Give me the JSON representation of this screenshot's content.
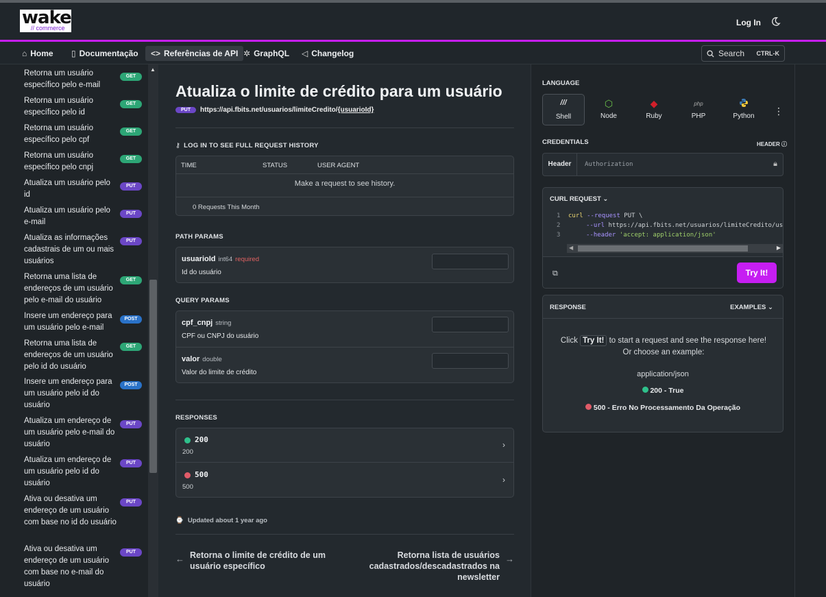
{
  "header": {
    "logo_text": "wake",
    "logo_sub": "// commerce",
    "login": "Log In"
  },
  "nav": {
    "items": [
      {
        "label": "Home",
        "icon": "home-icon"
      },
      {
        "label": "Documentação",
        "icon": "book-icon"
      },
      {
        "label": "Referências de API",
        "icon": "code-icon"
      },
      {
        "label": "GraphQL",
        "icon": "graphql-icon"
      },
      {
        "label": "Changelog",
        "icon": "megaphone-icon"
      }
    ],
    "search_label": "Search",
    "search_shortcut": "CTRL-K"
  },
  "sidebar": {
    "items": [
      {
        "label": "Retorna um usuário específico pelo e-mail",
        "method": "GET"
      },
      {
        "label": "Retorna um usuário específico pelo id",
        "method": "GET"
      },
      {
        "label": "Retorna um usuário específico pelo cpf",
        "method": "GET"
      },
      {
        "label": "Retorna um usuário específico pelo cnpj",
        "method": "GET"
      },
      {
        "label": "Atualiza um usuário pelo id",
        "method": "PUT"
      },
      {
        "label": "Atualiza um usuário pelo e-mail",
        "method": "PUT"
      },
      {
        "label": "Atualiza as informações cadastrais de um ou mais usuários",
        "method": "PUT"
      },
      {
        "label": "Retorna uma lista de endereços de um usuário pelo e-mail do usuário",
        "method": "GET"
      },
      {
        "label": "Insere um endereço para um usuário pelo e-mail",
        "method": "POST"
      },
      {
        "label": "Retorna uma lista de endereços de um usuário pelo id do usuário",
        "method": "GET"
      },
      {
        "label": "Insere um endereço para um usuário pelo id do usuário",
        "method": "POST"
      },
      {
        "label": "Atualiza um endereço de um usuário pelo e-mail do usuário",
        "method": "PUT"
      },
      {
        "label": "Atualiza um endereço de um usuário pelo id do usuário",
        "method": "PUT"
      },
      {
        "label": "Ativa ou desativa um endereço de um usuário com base no id do usuário",
        "method": "PUT"
      },
      {
        "label": "Ativa ou desativa um endereço de um usuário com base no e-mail do usuário",
        "method": "PUT"
      }
    ]
  },
  "main": {
    "title": "Atualiza o limite de crédito para um usuário",
    "method": "PUT",
    "url_base": "https://api.fbits.net/usuarios/limiteCredito/",
    "url_param": "{usuarioId}",
    "history_label": "LOG IN TO SEE FULL REQUEST HISTORY",
    "history_cols": [
      "TIME",
      "STATUS",
      "USER AGENT"
    ],
    "history_empty": "Make a request to see history.",
    "history_count": "0 Requests This Month",
    "path_params_label": "PATH PARAMS",
    "path_params": [
      {
        "name": "usuarioId",
        "type": "int64",
        "required": "required",
        "desc": "Id do usuário"
      }
    ],
    "query_params_label": "QUERY PARAMS",
    "query_params": [
      {
        "name": "cpf_cnpj",
        "type": "string",
        "desc": "CPF ou CNPJ do usuário"
      },
      {
        "name": "valor",
        "type": "double",
        "desc": "Valor do limite de crédito"
      }
    ],
    "responses_label": "RESPONSES",
    "responses": [
      {
        "code": "200",
        "desc": "200",
        "color": "#2fc08b"
      },
      {
        "code": "500",
        "desc": "500",
        "color": "#e05b68"
      }
    ],
    "updated": "Updated about 1 year ago",
    "prev_page": "Retorna o limite de crédito de um usuário específico",
    "next_page": "Retorna lista de usuários cadastrados/descadastrados na newsletter"
  },
  "right": {
    "language_label": "LANGUAGE",
    "languages": [
      {
        "name": "Shell",
        "icon": "shell-icon"
      },
      {
        "name": "Node",
        "icon": "node-icon"
      },
      {
        "name": "Ruby",
        "icon": "ruby-icon"
      },
      {
        "name": "PHP",
        "icon": "php-icon"
      },
      {
        "name": "Python",
        "icon": "python-icon"
      }
    ],
    "credentials_label": "CREDENTIALS",
    "header_link": "HEADER",
    "cred_header": "Header",
    "cred_placeholder": "Authorization",
    "curl_label": "CURL REQUEST",
    "code_lines": [
      {
        "n": "1",
        "cmd": "curl",
        "flag": "--request",
        "rest": " PUT \\"
      },
      {
        "n": "2",
        "flag": "--url",
        "rest": " https://api.fbits.net/usuarios/limiteCredito/usuarioId"
      },
      {
        "n": "3",
        "flag": "--header",
        "str": "'accept: application/json'"
      }
    ],
    "try_it": "Try It!",
    "response_label": "RESPONSE",
    "examples_label": "EXAMPLES",
    "msg_pre": "Click",
    "msg_kbd": "Try It!",
    "msg_post": "to start a request and see the response here! Or choose an example:",
    "mime": "application/json",
    "example_1": "200 - True",
    "example_2": "500 - Erro No Processamento Da Operação",
    "accent": "#c61ef2"
  }
}
